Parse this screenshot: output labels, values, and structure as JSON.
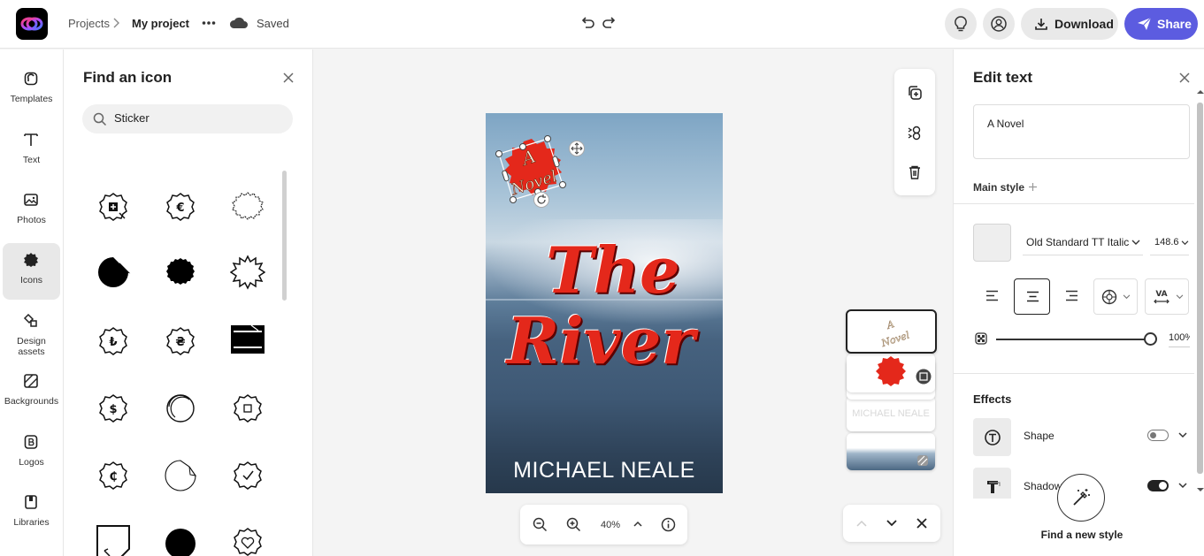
{
  "topbar": {
    "breadcrumb_projects": "Projects",
    "breadcrumb_current": "My project",
    "saved_status": "Saved",
    "download_label": "Download",
    "share_label": "Share",
    "accent_color": "#5c5ce0"
  },
  "rail": {
    "items": [
      {
        "label": "Templates",
        "icon": "templates-icon"
      },
      {
        "label": "Text",
        "icon": "text-icon"
      },
      {
        "label": "Photos",
        "icon": "photos-icon"
      },
      {
        "label": "Icons",
        "icon": "icons-icon",
        "active": true
      },
      {
        "label": "Design assets",
        "icon": "design-assets-icon"
      },
      {
        "label": "Backgrounds",
        "icon": "backgrounds-icon"
      },
      {
        "label": "Logos",
        "icon": "logos-icon"
      },
      {
        "label": "Libraries",
        "icon": "libraries-icon"
      }
    ]
  },
  "icon_panel": {
    "title": "Find an icon",
    "search_value": "Sticker",
    "results": [
      "sticker-plus-icon",
      "sticker-euro-icon",
      "sticker-outline-icon",
      "sticker-peel-filled-icon",
      "sticker-filled-icon",
      "sticker-burst-icon",
      "sticker-lira-icon",
      "sticker-hryvnia-icon",
      "sticker-film-icon",
      "sticker-dollar-icon",
      "sticker-round-peel-icon",
      "sticker-square-icon",
      "sticker-cedi-icon",
      "sticker-circle-peel-icon",
      "sticker-check-icon",
      "sticker-corner-icon",
      "sticker-blob-icon",
      "sticker-heart-icon"
    ]
  },
  "canvas": {
    "badge_text_1": "A",
    "badge_text_2": "Novel",
    "title_line_1": "The",
    "title_line_2": "River",
    "author": "MICHAEL NEALE",
    "zoom": "40%",
    "title_color": "#e4281b"
  },
  "edit_panel": {
    "title": "Edit text",
    "text_value": "A Novel",
    "main_style_label": "Main style",
    "font_name": "Old Standard TT Italic",
    "font_size": "148.6",
    "opacity": "100%",
    "opacity_level": 1.0,
    "effects_label": "Effects",
    "effects": [
      {
        "name": "Shape",
        "enabled": false
      },
      {
        "name": "Shadow",
        "enabled": true
      }
    ],
    "find_style_label": "Find a new style"
  }
}
